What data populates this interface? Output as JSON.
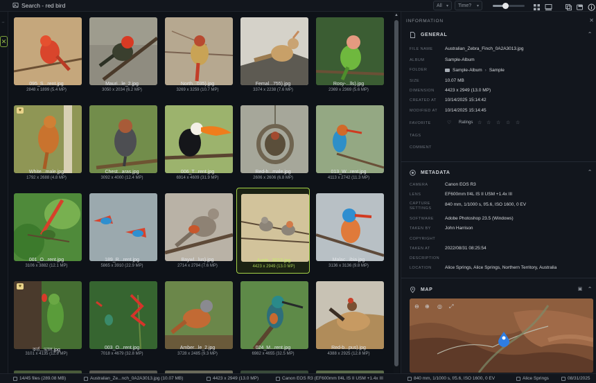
{
  "topbar": {
    "search_title": "Search - red bird",
    "filter_all": "All",
    "filter_time": "Time?",
    "zoom_level": 0.4
  },
  "grid": {
    "items": [
      {
        "filename": "095_S...rent.jpg",
        "meta": "2848 x 1899 (5.4 MP)"
      },
      {
        "filename": "Mauri...le_2.jpg",
        "meta": "3050 x 2034 (6.2 MP)"
      },
      {
        "filename": "North...035).jpg",
        "meta": "3269 x 3259 (10.7 MP)"
      },
      {
        "filename": "Femal...755).jpg",
        "meta": "3374 x 2238 (7.6 MP)"
      },
      {
        "filename": "Rosy-...lls).jpg",
        "meta": "2369 x 2369 (5.6 MP)"
      },
      {
        "filename": "White...male.jpg",
        "meta": "1792 x 2688 (4.8 MP)"
      },
      {
        "filename": "Chest...aras.jpg",
        "meta": "3092 x 4000 (12.4 MP)"
      },
      {
        "filename": "006_T...rent.jpg",
        "meta": "6914 x 4609 (31.9 MP)"
      },
      {
        "filename": "Red-h...male.jpg",
        "meta": "2606 x 2606 (6.8 MP)"
      },
      {
        "filename": "013_W...rent.jpg",
        "meta": "4113 x 2742 (11.3 MP)"
      },
      {
        "filename": "001_O...rent.jpg",
        "meta": "3106 x 3882 (12.1 MP)"
      },
      {
        "filename": "189_R...rent.jpg",
        "meta": "5865 x 3910 (22.9 MP)"
      },
      {
        "filename": "Baywl...lus).jpg",
        "meta": "2714 x 2794 (7.6 MP)"
      },
      {
        "filename": "Austr...3013.jpg",
        "meta": "4423 x 2949 (13.0 MP)"
      },
      {
        "filename": "Malac...ibia.jpg",
        "meta": "3136 x 3136 (9.8 MP)"
      },
      {
        "filename": "কর্ত...ভাল.jpg",
        "meta": "3101 x 4135 (12.8 MP)"
      },
      {
        "filename": "003_O...rent.jpg",
        "meta": "7018 x 4679 (32.8 MP)"
      },
      {
        "filename": "Amber...le_2.jpg",
        "meta": "3728 x 2485 (9.3 MP)"
      },
      {
        "filename": "024_M...rent.jpg",
        "meta": "6982 x 4655 (32.5 MP)"
      },
      {
        "filename": "Red-b...pus).jpg",
        "meta": "4388 x 2925 (12.8 MP)"
      }
    ]
  },
  "info": {
    "header": "INFORMATION",
    "general": {
      "title": "GENERAL",
      "file_name_label": "FILE NAME",
      "file_name": "Australian_Zebra_Finch_0A2A3013.jpg",
      "album_label": "ALBUM",
      "album": "Sample-Album",
      "folder_label": "FOLDER",
      "folder_1": "Sample-Album",
      "folder_sep": "›",
      "folder_2": "Sample",
      "size_label": "SIZE",
      "size": "10.07 MB",
      "dimension_label": "DIMENSION",
      "dimension": "4423 x 2949 (13.0 MP)",
      "created_label": "CREATED AT",
      "created": "10/14/2025 15:14:42",
      "modified_label": "MODIFIED AT",
      "modified": "10/14/2025 15:14:45",
      "favorite_label": "FAVORITE",
      "ratings_label": "Ratings",
      "tags_label": "TAGS",
      "comment_label": "COMMENT"
    },
    "metadata": {
      "title": "METADATA",
      "camera_label": "CAMERA",
      "camera": "Canon EOS R3",
      "lens_label": "LENS",
      "lens": "EF600mm f/4L IS II USM +1.4x III",
      "capture_label": "CAPTURE SETTINGS",
      "capture": "840 mm, 1/1000 s, f/5.6, ISO 1600, 0 EV",
      "software_label": "SOFTWARE",
      "software": "Adobe Photoshop 23.5 (Windows)",
      "taken_by_label": "TAKEN BY",
      "taken_by": "John Harrison",
      "copyright_label": "COPYRIGHT",
      "taken_at_label": "TAKEN AT",
      "taken_at": "2022/08/31 08:25:54",
      "description_label": "DESCRIPTION",
      "location_label": "LOCATION",
      "location": "Alice Springs, Alice Springs, Northern Territory, Australia"
    },
    "map": {
      "title": "MAP"
    }
  },
  "status": {
    "files": "14/45 files (289.08 MB)",
    "file": "Australian_Ze...nch_0A2A3013.jpg (10.07 MB)",
    "dims": "4423 x 2949 (13.0 MP)",
    "camera": "Canon EOS R3 (EF600mm f/4L IS II USM +1.4x III",
    "capture": "840 mm, 1/1000 s, f/5.6, ISO 1600, 0 EV",
    "place": "Alice Springs",
    "date": "08/31/2025"
  },
  "colors": {
    "accent": "#a6d448",
    "bg": "#0e1218",
    "panel": "#12161d"
  }
}
